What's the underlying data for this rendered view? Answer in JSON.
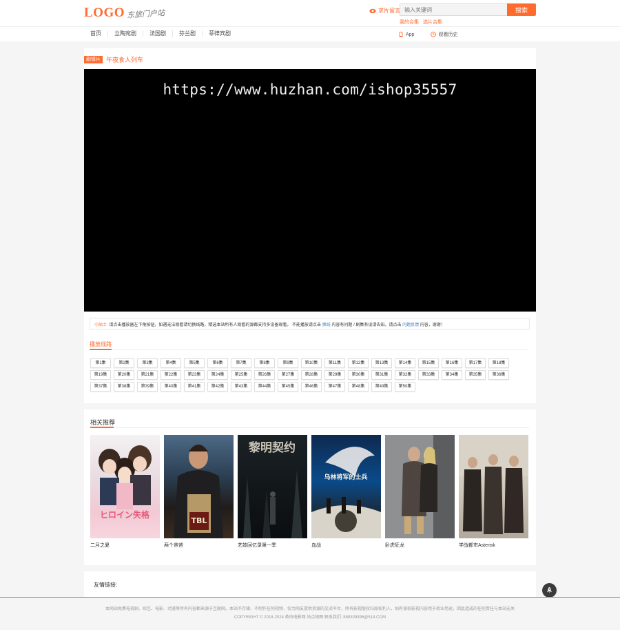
{
  "header": {
    "logo": "LOGO",
    "slogan": "东旅门户站",
    "wish_label": "求片留言",
    "search_placeholder": "输入关键词",
    "search_button": "搜索",
    "hot_links": [
      "我的合集",
      "选片合集"
    ]
  },
  "nav": {
    "items": [
      "首页",
      "立陶宛剧",
      "法国剧",
      "芬兰剧",
      "菲律宾剧"
    ],
    "app_label": "App",
    "history_label": "观看历史"
  },
  "player": {
    "tag": "剧情片",
    "title": "午夜食人列车",
    "watermark": "https://www.huzhan.com/ishop35557"
  },
  "notice": {
    "lead": "小贴士:",
    "text_1": "请点击播放器左下角按钮，如遇无法观看请切换线路，精选本站所有人观看的源都支持多设备观看。",
    "text_2": "不能播放请点击",
    "link_1": "换线",
    "text_3": "内容有问题 / 剧集有误请告知。请点击",
    "link_2": "问题反馈",
    "text_4": "内容，谢谢！"
  },
  "episodes": {
    "title": "播放线路",
    "items": [
      "第1集",
      "第2集",
      "第3集",
      "第4集",
      "第5集",
      "第6集",
      "第7集",
      "第8集",
      "第9集",
      "第10集",
      "第11集",
      "第12集",
      "第13集",
      "第14集",
      "第15集",
      "第16集",
      "第17集",
      "第18集",
      "第19集",
      "第20集",
      "第21集",
      "第22集",
      "第23集",
      "第24集",
      "第25集",
      "第26集",
      "第27集",
      "第28集",
      "第29集",
      "第30集",
      "第31集",
      "第32集",
      "第33集",
      "第34集",
      "第35集",
      "第36集",
      "第37集",
      "第38集",
      "第39集",
      "第40集",
      "第41集",
      "第42集",
      "第43集",
      "第44集",
      "第45集",
      "第46集",
      "第47集",
      "第48集",
      "第49集",
      "第50集"
    ]
  },
  "recommend": {
    "title": "相关推荐",
    "items": [
      {
        "caption": "二月之夏"
      },
      {
        "caption": "两个爸爸"
      },
      {
        "caption": "艺妓回忆录第一季"
      },
      {
        "caption": "血战"
      },
      {
        "caption": "卧虎狂龙"
      },
      {
        "caption": "学战都市Asterisk"
      }
    ],
    "poster_texts": [
      "ヒロイン失格",
      "TBL",
      "黎明契约",
      "乌林将军的士兵"
    ]
  },
  "links": {
    "label": "友情链接:"
  },
  "footer": {
    "line1": "本网站免费电视剧、综艺、电影、动漫等所有内容都来源于互联网。本站不存储、不制作任何视频，仅为网友提供资源的交流平台，所有影视版权归原权利人。如有侵权影视内容用于商业用途，因此造成的任何责任与本站无关",
    "line2": "COPYRIGHT © 2018-2024 茶白电影网 站点地图 联系我们: 888309396@514.COM"
  },
  "colors": {
    "accent": "#ff6a2f",
    "link": "#3b82c4"
  }
}
